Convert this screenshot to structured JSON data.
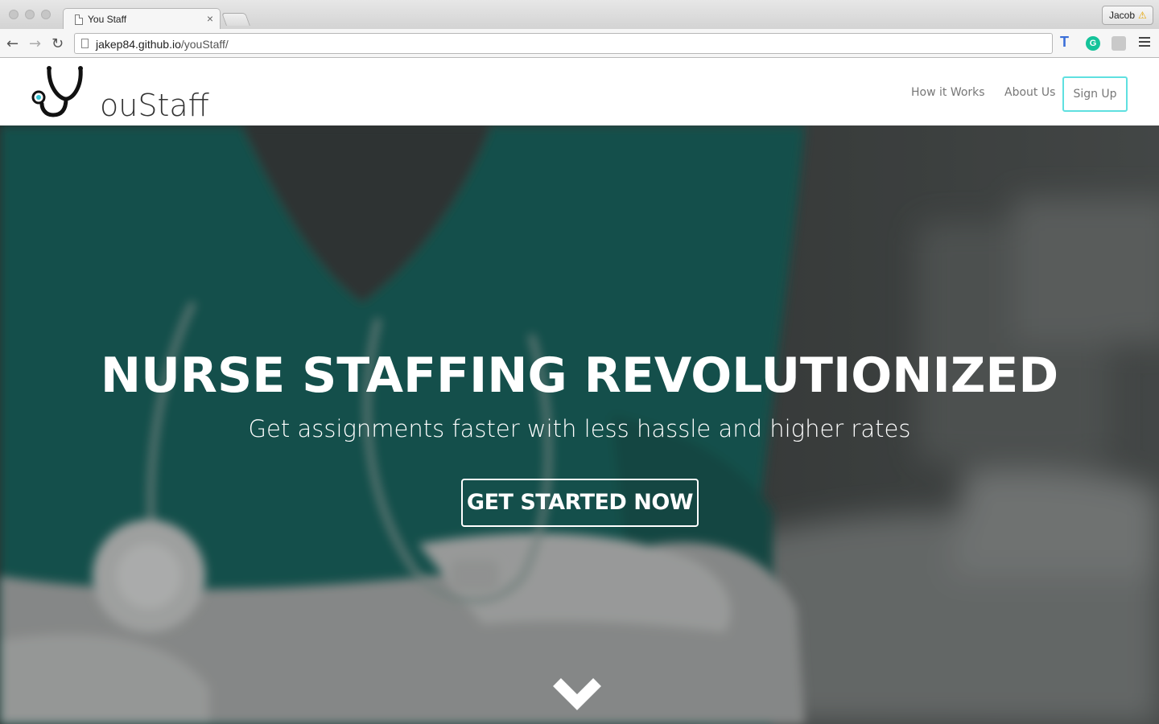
{
  "browser": {
    "tab_title": "You Staff",
    "tab_close": "×",
    "profile_name": "Jacob",
    "profile_warning_icon": "warning-icon",
    "url_host": "jakep84.github.io",
    "url_path": "/youStaff/",
    "back_icon": "←",
    "forward_icon": "→",
    "reload_icon": "↻",
    "extensions": [
      "translate-icon",
      "grammarly-icon",
      "puzzle-icon"
    ],
    "grammarly_letter": "G",
    "translate_letter": "T"
  },
  "site": {
    "logo_text": "ouStaff",
    "nav": {
      "how_it_works": "How it Works",
      "about_us": "About Us",
      "sign_up": "Sign Up"
    },
    "colors": {
      "accent": "#5fe0e0",
      "scrubs": "#1f7f78"
    }
  },
  "hero": {
    "title": "NURSE STAFFING REVOLUTIONIZED",
    "subtitle": "Get assignments faster with less hassle and higher rates",
    "cta": "GET STARTED NOW",
    "scroll_icon": "chevron-down-icon"
  }
}
